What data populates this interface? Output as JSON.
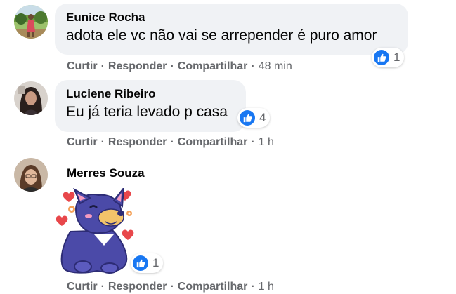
{
  "comments": [
    {
      "author": "Eunice Rocha",
      "text": "adota ele vc não vai se arrepender é puro amor",
      "reaction_icon": "like-icon",
      "reaction_count": "1",
      "actions": {
        "like": "Curtir",
        "reply": "Responder",
        "share": "Compartilhar"
      },
      "separator": "·",
      "time": "48 min"
    },
    {
      "author": "Luciene Ribeiro",
      "text": "Eu já teria levado p casa",
      "reaction_icon": "like-icon",
      "reaction_count": "4",
      "actions": {
        "like": "Curtir",
        "reply": "Responder",
        "share": "Compartilhar"
      },
      "separator": "·",
      "time": "1 h"
    },
    {
      "author": "Merres Souza",
      "sticker": "dog-hearts-sticker",
      "reaction_icon": "like-icon",
      "reaction_count": "1",
      "actions": {
        "like": "Curtir",
        "reply": "Responder",
        "share": "Compartilhar"
      },
      "separator": "·",
      "time": "1 h"
    }
  ],
  "colors": {
    "bubble_bg": "#f0f2f5",
    "text": "#050505",
    "secondary_text": "#65676b",
    "like_blue": "#1877f2",
    "sticker_dog": "#4b4aa8",
    "sticker_heart": "#e8474b"
  }
}
